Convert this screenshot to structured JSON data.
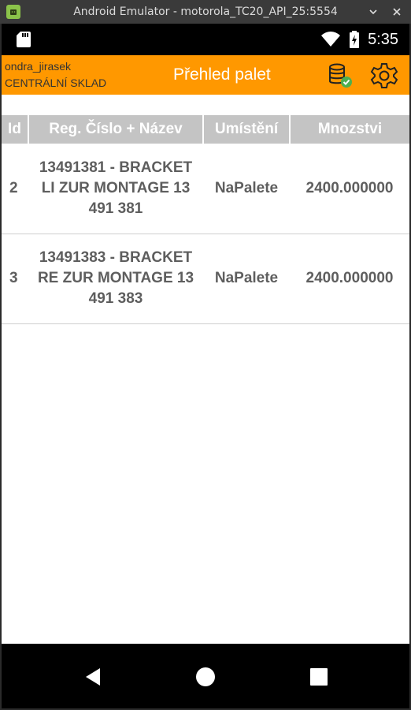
{
  "window": {
    "title": "Android Emulator - motorola_TC20_API_25:5554"
  },
  "status_bar": {
    "time": "5:35",
    "icons": [
      "sd-card-icon",
      "wifi-icon",
      "battery-charging-icon"
    ]
  },
  "app_bar": {
    "user": "ondra_jirasek",
    "warehouse": "CENTRÁLNÍ SKLAD",
    "title": "Přehled palet",
    "icons": [
      "database-check-icon",
      "settings-gear-icon"
    ],
    "accent_color": "#ff9800"
  },
  "table": {
    "headers": {
      "id": "Id",
      "name": "Reg. Číslo + Název",
      "location": "Umístění",
      "quantity": "Mnozstvi"
    },
    "rows": [
      {
        "id": "2",
        "name": "13491381 - BRACKET LI ZUR MONTAGE 13 491 381",
        "location": "NaPalete",
        "quantity": "2400.000000"
      },
      {
        "id": "3",
        "name": "13491383 - BRACKET RE ZUR MONTAGE 13 491 383",
        "location": "NaPalete",
        "quantity": "2400.000000"
      }
    ]
  },
  "nav_bar": {
    "icons": [
      "back-icon",
      "home-icon",
      "recents-icon"
    ]
  }
}
